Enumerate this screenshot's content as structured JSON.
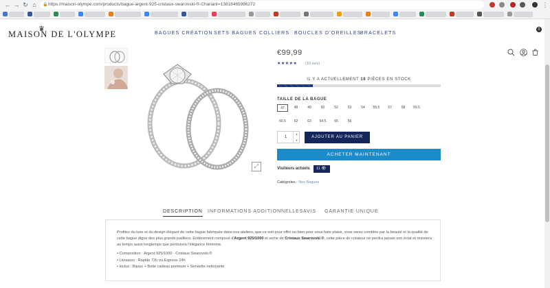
{
  "browser": {
    "url": "https://maison-olympe.com/products/bague-argent-925-cristaux-swarovski-®-Chariant=13818465986272"
  },
  "header": {
    "logo": "Maison de l'Olympe",
    "nav": [
      "BAGUES CRÉATION",
      "SETS BAGUES",
      "COLLIERS",
      "BOUCLES D'OREILLES",
      "BRACELETS"
    ],
    "cart_count": "0"
  },
  "product": {
    "price": "€99,99",
    "stars": "★★★★★",
    "reviews": "(10 avis)",
    "stock_prefix": "IL Y A ACTUELLEMENT ",
    "stock_count": "18",
    "stock_suffix": " PIÈCES EN STOCK",
    "stock_fraction": 0.22,
    "size_title": "TAILLE DE LA BAGUE",
    "sizes_row1": [
      "47",
      "48",
      "49",
      "50",
      "52",
      "53",
      "54",
      "55.5",
      "57",
      "58",
      "59.5"
    ],
    "sizes_row2": [
      "60.5",
      "62",
      "63",
      "64.5",
      "65",
      "56"
    ],
    "selected_size": "47",
    "quantity": "1",
    "add_to_cart": "AJOUTER AU PANIER",
    "buy_now": "ACHETER MAINTENANT",
    "visitors_label": "Visiteurs actuels",
    "visitors_count": "11",
    "categories_label": "Catégories :",
    "categories_value": "Nos Bagues"
  },
  "tabs": [
    "DESCRIPTION",
    "INFORMATIONS ADDITIONNELLES",
    "AVIS",
    "GARANTIE UNIQUE"
  ],
  "description": {
    "p1": "Profitez du luxe et du design élégant de cette bague fabriquée dans nos ateliers, que ce soit pour offrir ou bien pour vous faire plaisir, vous serez comblée par la beauté et la qualité de cette bague digne des plus grands joailliers. Entièrement composé d'",
    "p1_bold1": "Argent 925/1000",
    "p1_mid": " et sertie de ",
    "p1_bold2": "Cristaux Swarovski ®",
    "p1_end": ", cette pièce de créateur ne perdra jamais son éclat et résistera au temps aussi longtemps que perdurera l'élégance féminine.",
    "bullets": [
      "Composition : Argent 925/1000 - Cristaux Swarovski ®",
      "Livraison : Rapide 72h ou Express 24h",
      "Inclus : Bijoux + Boite cadeau premium + Serviette nettoyante"
    ]
  }
}
